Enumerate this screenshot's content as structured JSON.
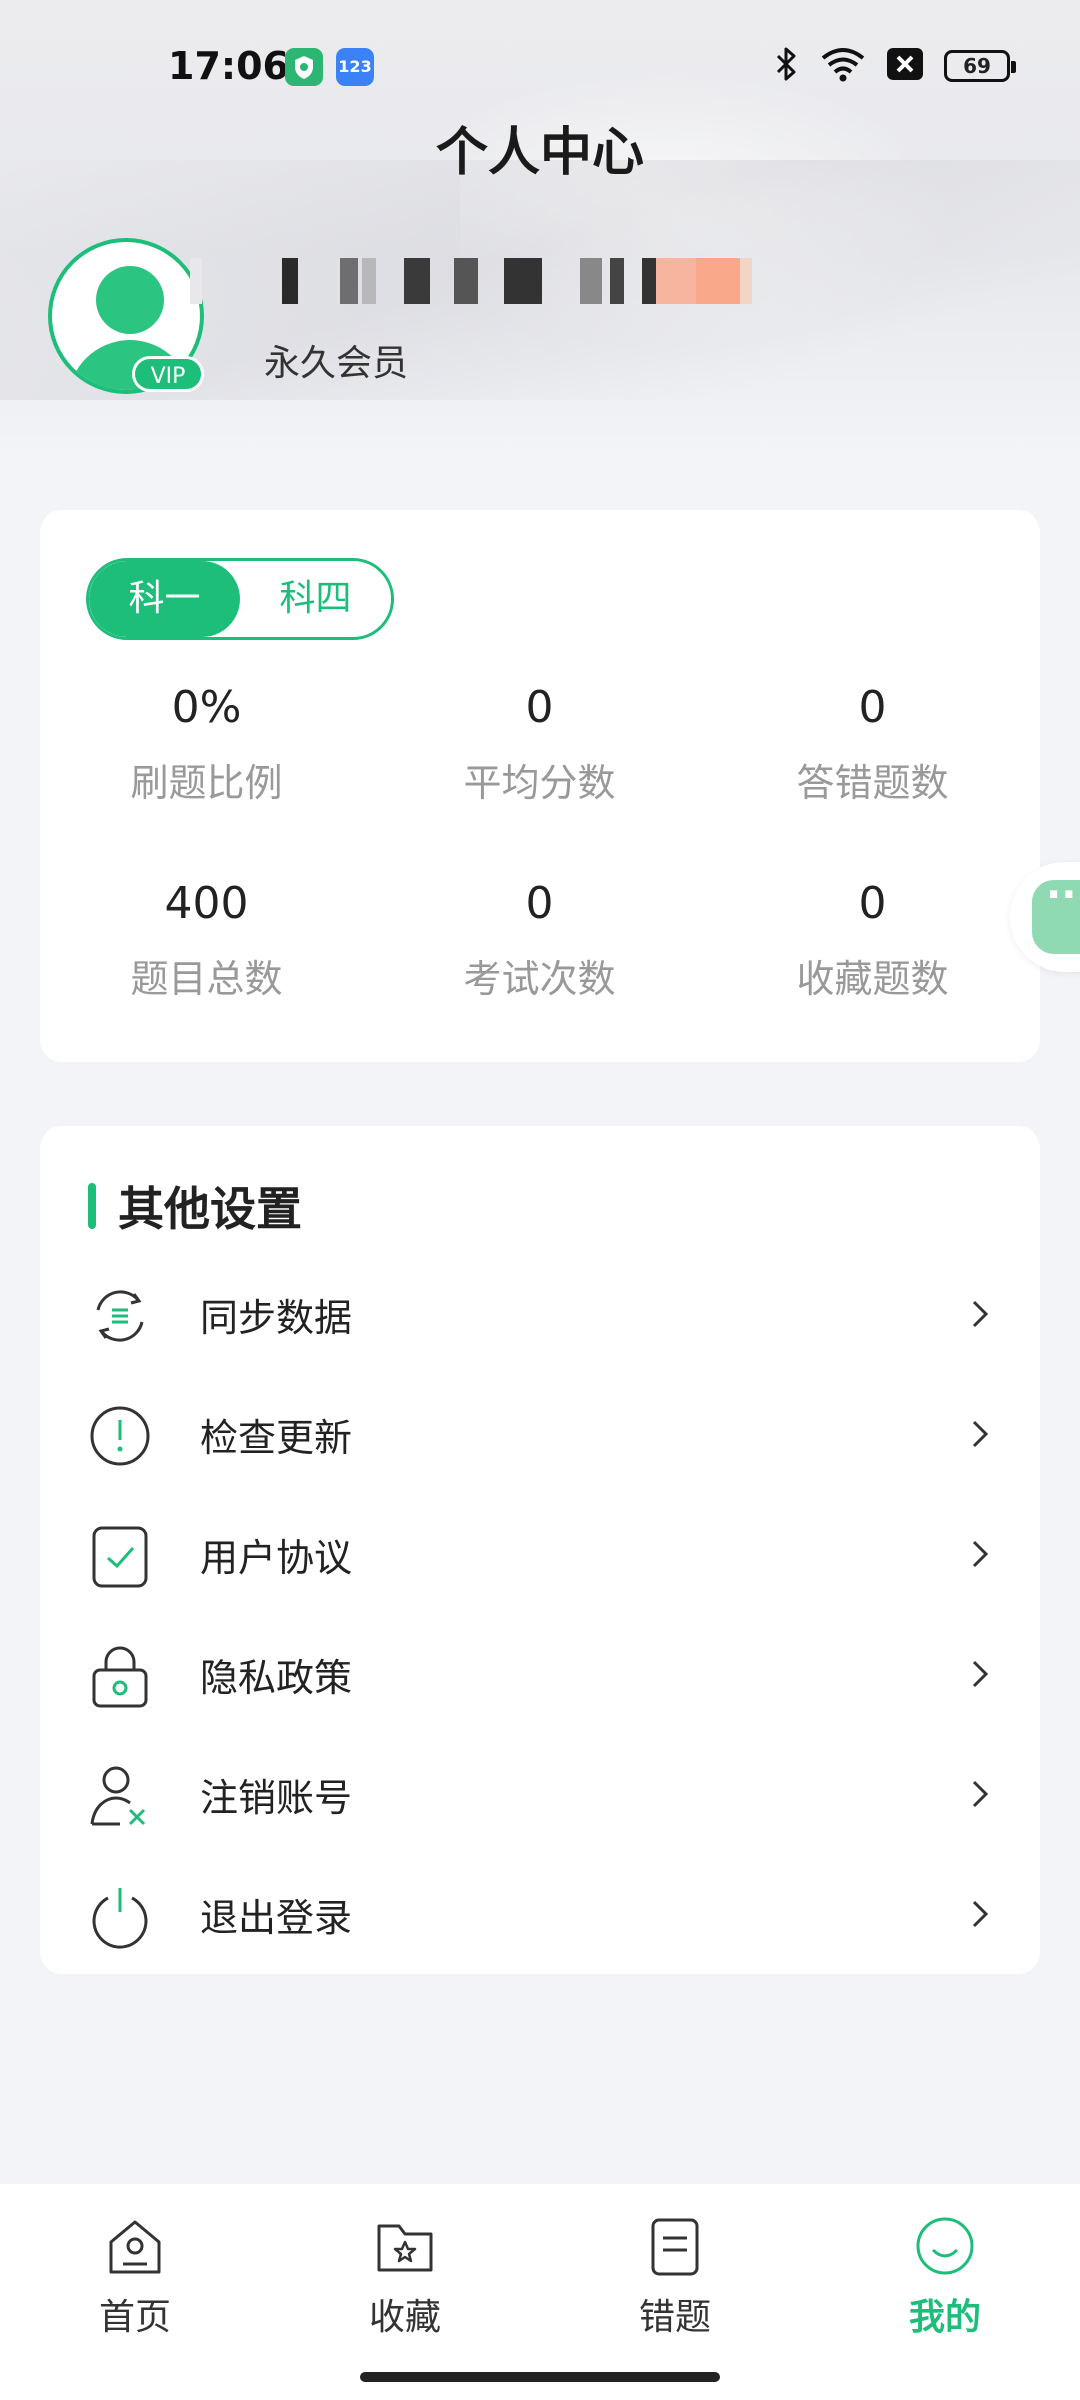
{
  "status_bar": {
    "time": "17:06",
    "app_icon_2_text": "123",
    "battery": "69"
  },
  "header": {
    "title": "个人中心"
  },
  "profile": {
    "member_type": "永久会员",
    "vip_badge": "VIP"
  },
  "subjects": {
    "options": [
      "科一",
      "科四"
    ],
    "selected": "科一"
  },
  "stats": [
    {
      "value": "0%",
      "label": "刷题比例"
    },
    {
      "value": "0",
      "label": "平均分数"
    },
    {
      "value": "0",
      "label": "答错题数"
    },
    {
      "value": "400",
      "label": "题目总数"
    },
    {
      "value": "0",
      "label": "考试次数"
    },
    {
      "value": "0",
      "label": "收藏题数"
    }
  ],
  "settings": {
    "title": "其他设置",
    "items": [
      {
        "label": "同步数据",
        "icon": "sync-icon"
      },
      {
        "label": "检查更新",
        "icon": "alert-circle-icon"
      },
      {
        "label": "用户协议",
        "icon": "checkbox-icon"
      },
      {
        "label": "隐私政策",
        "icon": "lock-icon"
      },
      {
        "label": "注销账号",
        "icon": "user-remove-icon"
      },
      {
        "label": "退出登录",
        "icon": "power-icon"
      }
    ]
  },
  "bottom_nav": {
    "items": [
      {
        "label": "首页",
        "icon": "home-icon"
      },
      {
        "label": "收藏",
        "icon": "folder-star-icon"
      },
      {
        "label": "错题",
        "icon": "document-icon"
      },
      {
        "label": "我的",
        "icon": "smile-icon"
      }
    ],
    "active": "我的"
  },
  "colors": {
    "accent": "#1dbd7a",
    "background": "#f3f4f8",
    "label_gray": "#999999"
  }
}
